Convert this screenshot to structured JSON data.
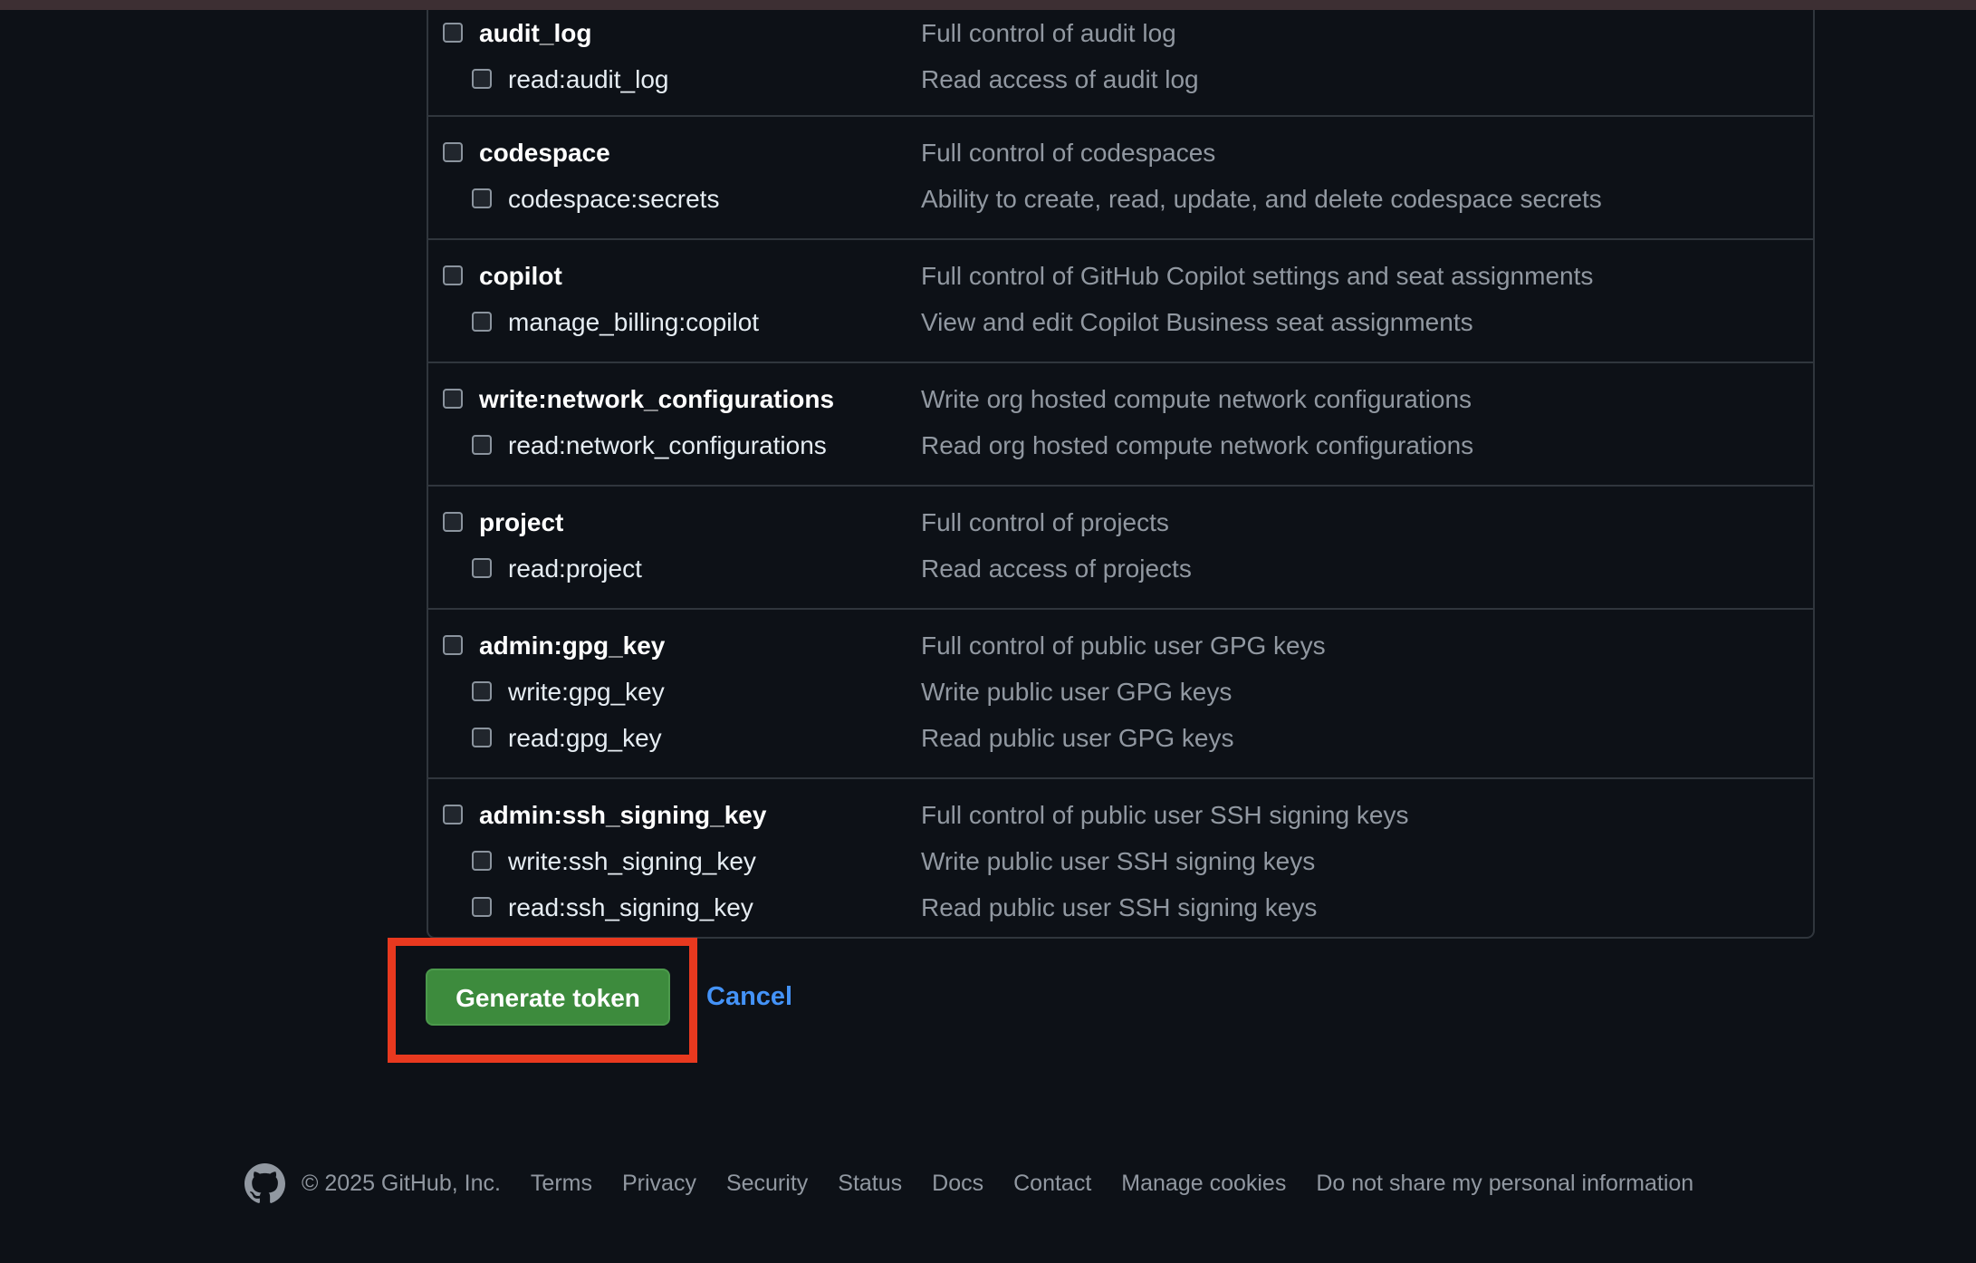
{
  "scopes": [
    {
      "parent": {
        "name": "audit_log",
        "desc": "Full control of audit log"
      },
      "children": [
        {
          "name": "read:audit_log",
          "desc": "Read access of audit log"
        }
      ]
    },
    {
      "parent": {
        "name": "codespace",
        "desc": "Full control of codespaces"
      },
      "children": [
        {
          "name": "codespace:secrets",
          "desc": "Ability to create, read, update, and delete codespace secrets"
        }
      ]
    },
    {
      "parent": {
        "name": "copilot",
        "desc": "Full control of GitHub Copilot settings and seat assignments"
      },
      "children": [
        {
          "name": "manage_billing:copilot",
          "desc": "View and edit Copilot Business seat assignments"
        }
      ]
    },
    {
      "parent": {
        "name": "write:network_configurations",
        "desc": "Write org hosted compute network configurations"
      },
      "children": [
        {
          "name": "read:network_configurations",
          "desc": "Read org hosted compute network configurations"
        }
      ]
    },
    {
      "parent": {
        "name": "project",
        "desc": "Full control of projects"
      },
      "children": [
        {
          "name": "read:project",
          "desc": "Read access of projects"
        }
      ]
    },
    {
      "parent": {
        "name": "admin:gpg_key",
        "desc": "Full control of public user GPG keys"
      },
      "children": [
        {
          "name": "write:gpg_key",
          "desc": "Write public user GPG keys"
        },
        {
          "name": "read:gpg_key",
          "desc": "Read public user GPG keys"
        }
      ]
    },
    {
      "parent": {
        "name": "admin:ssh_signing_key",
        "desc": "Full control of public user SSH signing keys"
      },
      "children": [
        {
          "name": "write:ssh_signing_key",
          "desc": "Write public user SSH signing keys"
        },
        {
          "name": "read:ssh_signing_key",
          "desc": "Read public user SSH signing keys"
        }
      ]
    }
  ],
  "actions": {
    "generate_label": "Generate token",
    "cancel_label": "Cancel"
  },
  "footer": {
    "copyright": "© 2025 GitHub, Inc.",
    "links": [
      "Terms",
      "Privacy",
      "Security",
      "Status",
      "Docs",
      "Contact",
      "Manage cookies",
      "Do not share my personal information"
    ]
  },
  "colors": {
    "background": "#0d1117",
    "primary_button": "#3d8b3d",
    "link": "#4493f8",
    "highlight": "#e8391f"
  }
}
